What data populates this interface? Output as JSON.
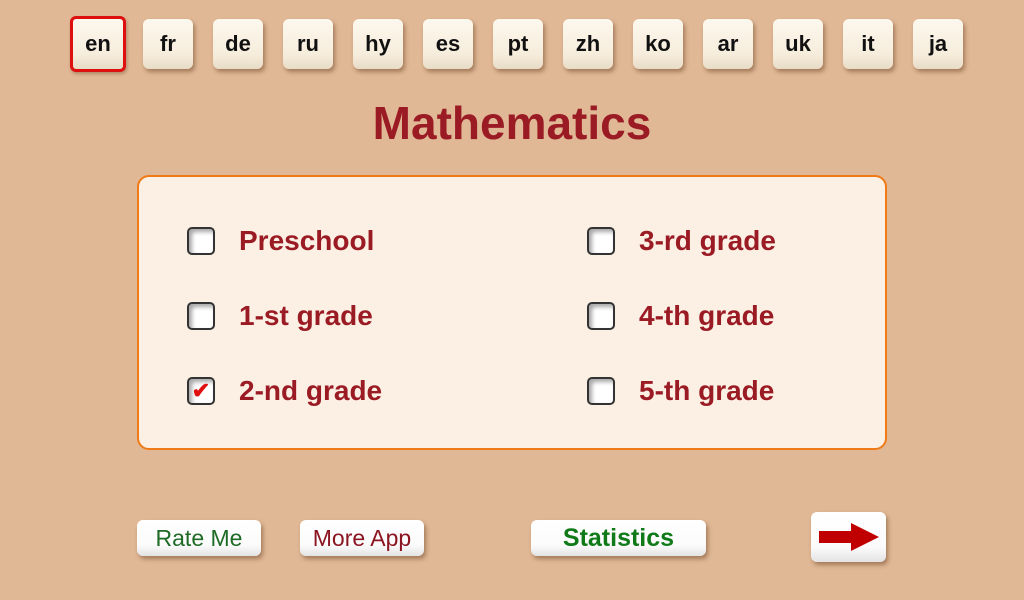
{
  "languages": [
    {
      "code": "en",
      "selected": true
    },
    {
      "code": "fr"
    },
    {
      "code": "de"
    },
    {
      "code": "ru"
    },
    {
      "code": "hy"
    },
    {
      "code": "es"
    },
    {
      "code": "pt"
    },
    {
      "code": "zh"
    },
    {
      "code": "ko"
    },
    {
      "code": "ar"
    },
    {
      "code": "uk"
    },
    {
      "code": "it"
    },
    {
      "code": "ja"
    }
  ],
  "title": "Mathematics",
  "grades": [
    {
      "label": "Preschool",
      "checked": false
    },
    {
      "label": "1-st grade",
      "checked": false
    },
    {
      "label": "2-nd grade",
      "checked": true
    },
    {
      "label": "3-rd grade",
      "checked": false
    },
    {
      "label": "4-th grade",
      "checked": false
    },
    {
      "label": "5-th grade",
      "checked": false
    }
  ],
  "check_glyph": "✔",
  "buttons": {
    "rate": "Rate Me",
    "more": "More App",
    "stats": "Statistics",
    "next_icon": "arrow-right-icon"
  },
  "colors": {
    "background": "#e0b896",
    "title": "#9b1b25",
    "panel_border": "#f07a16",
    "selected_border": "#dd0f0f",
    "rate_text": "#1e6b25",
    "more_text": "#8b1520",
    "stats_text": "#0f7a17",
    "arrow": "#c00000"
  }
}
